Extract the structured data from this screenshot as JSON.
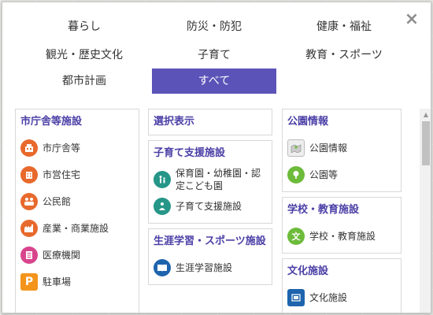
{
  "tabs": [
    {
      "label": "暮らし"
    },
    {
      "label": "防災・防犯"
    },
    {
      "label": "健康・福祉"
    },
    {
      "label": "観光・歴史文化"
    },
    {
      "label": "子育て"
    },
    {
      "label": "教育・スポーツ"
    },
    {
      "label": "都市計画"
    },
    {
      "label": "すべて",
      "active": true
    }
  ],
  "close_glyph": "×",
  "columns": [
    {
      "panels": [
        {
          "title": "市庁舎等施設",
          "items": [
            {
              "label": "市庁舎等",
              "icon": "city-hall-icon"
            },
            {
              "label": "市営住宅",
              "icon": "municipal-housing-icon"
            },
            {
              "label": "公民館",
              "icon": "community-center-icon"
            },
            {
              "label": "産業・商業施設",
              "icon": "industry-commerce-icon"
            },
            {
              "label": "医療機関",
              "icon": "medical-icon"
            },
            {
              "label": "駐車場",
              "icon": "parking-icon",
              "glyph": "P"
            }
          ]
        }
      ]
    },
    {
      "panels": [
        {
          "title": "選択表示",
          "items": []
        },
        {
          "title": "子育て支援施設",
          "items": [
            {
              "label": "保育園・幼稚園・認定こども園",
              "icon": "nursery-icon"
            },
            {
              "label": "子育て支援施設",
              "icon": "childcare-support-icon"
            }
          ]
        },
        {
          "title": "生涯学習・スポーツ施設",
          "items": [
            {
              "label": "生涯学習施設",
              "icon": "lifelong-learning-icon"
            }
          ]
        }
      ]
    },
    {
      "panels": [
        {
          "title": "公園情報",
          "items": [
            {
              "label": "公園情報",
              "icon": "park-info-icon"
            },
            {
              "label": "公園等",
              "icon": "park-icon"
            }
          ]
        },
        {
          "title": "学校・教育施設",
          "items": [
            {
              "label": "学校・教育施設",
              "icon": "school-icon",
              "glyph": "文"
            }
          ]
        },
        {
          "title": "文化施設",
          "items": [
            {
              "label": "文化施設",
              "icon": "cultural-facility-icon"
            }
          ]
        }
      ]
    }
  ]
}
